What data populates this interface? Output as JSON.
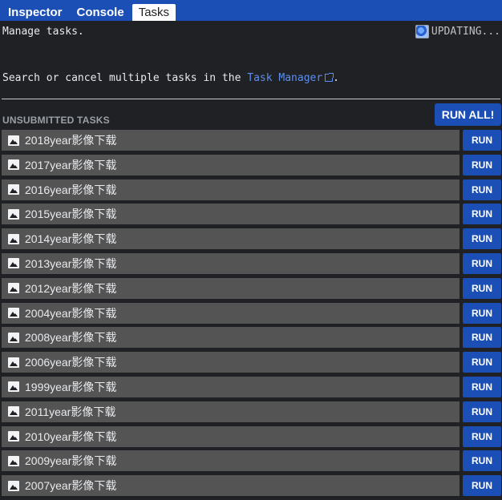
{
  "tabs": [
    {
      "label": "Inspector",
      "active": false
    },
    {
      "label": "Console",
      "active": false
    },
    {
      "label": "Tasks",
      "active": true
    }
  ],
  "header": {
    "manage_text": "Manage tasks.",
    "status_icon": "updating-icon",
    "status_text": "UPDATING..."
  },
  "info": {
    "prefix": "Search or cancel multiple tasks in the ",
    "link_text": "Task Manager",
    "suffix": "."
  },
  "section": {
    "label": "UNSUBMITTED TASKS",
    "run_all_label": "RUN ALL!"
  },
  "tasks": [
    {
      "name": "2018year影像下载",
      "run_label": "RUN"
    },
    {
      "name": "2017year影像下载",
      "run_label": "RUN"
    },
    {
      "name": "2016year影像下载",
      "run_label": "RUN"
    },
    {
      "name": "2015year影像下载",
      "run_label": "RUN"
    },
    {
      "name": "2014year影像下载",
      "run_label": "RUN"
    },
    {
      "name": "2013year影像下载",
      "run_label": "RUN"
    },
    {
      "name": "2012year影像下载",
      "run_label": "RUN"
    },
    {
      "name": "2004year影像下载",
      "run_label": "RUN"
    },
    {
      "name": "2008year影像下载",
      "run_label": "RUN"
    },
    {
      "name": "2006year影像下载",
      "run_label": "RUN"
    },
    {
      "name": "1999year影像下载",
      "run_label": "RUN"
    },
    {
      "name": "2011year影像下载",
      "run_label": "RUN"
    },
    {
      "name": "2010year影像下载",
      "run_label": "RUN"
    },
    {
      "name": "2009year影像下载",
      "run_label": "RUN"
    },
    {
      "name": "2007year影像下载",
      "run_label": "RUN"
    }
  ],
  "colors": {
    "accent": "#1b4fb6",
    "background": "#202124",
    "row": "#545454",
    "link": "#5c8ff0"
  }
}
